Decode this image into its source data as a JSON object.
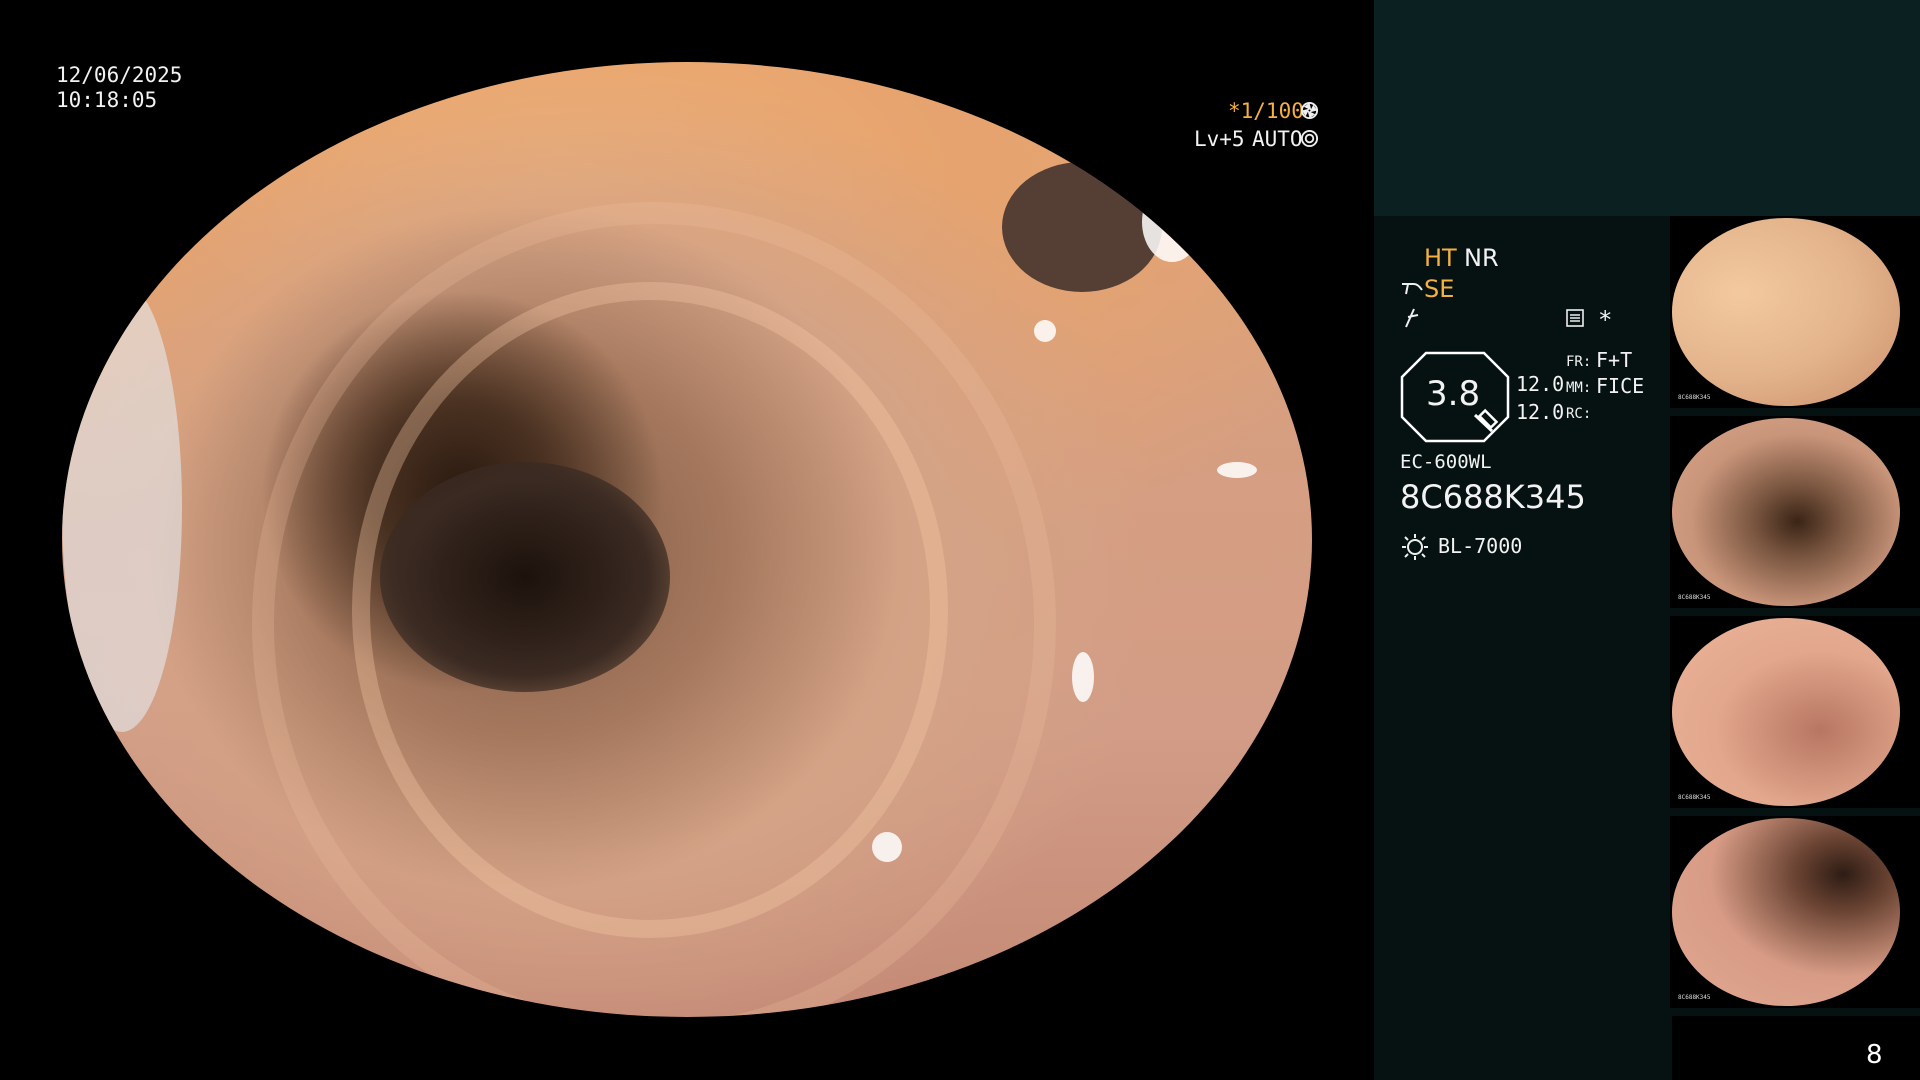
{
  "overlay": {
    "date": "12/06/2025",
    "time": "10:18:05",
    "shutter": "*1/100",
    "level": "Lv+5",
    "mode": "AUTO"
  },
  "info": {
    "ht": "HT",
    "nr": "NR",
    "se": "SE",
    "star": "*",
    "zoom_value": "3.8",
    "value_top": "12.0",
    "value_bottom": "12.0",
    "fr_label": "FR:",
    "fr_value": "F+T",
    "mm_label": "MM:",
    "mm_value": "FICE",
    "rc_label": "RC:",
    "scope_model": "EC-600WL",
    "serial": "8C688K345",
    "light_source": "BL-7000"
  },
  "thumbnails": [
    {
      "id": 1,
      "serial": "8C688K345",
      "tone": "#e4b58c"
    },
    {
      "id": 2,
      "serial": "8C688K345",
      "tone": "#c9957a"
    },
    {
      "id": 3,
      "serial": "8C688K345",
      "tone": "#e2a78c"
    },
    {
      "id": 4,
      "serial": "8C688K345",
      "tone": "#d89c86"
    }
  ],
  "page": {
    "number": "8"
  },
  "colors": {
    "accent": "#f5b041",
    "panel_dark": "#061212",
    "panel_teal": "#0b2121"
  }
}
